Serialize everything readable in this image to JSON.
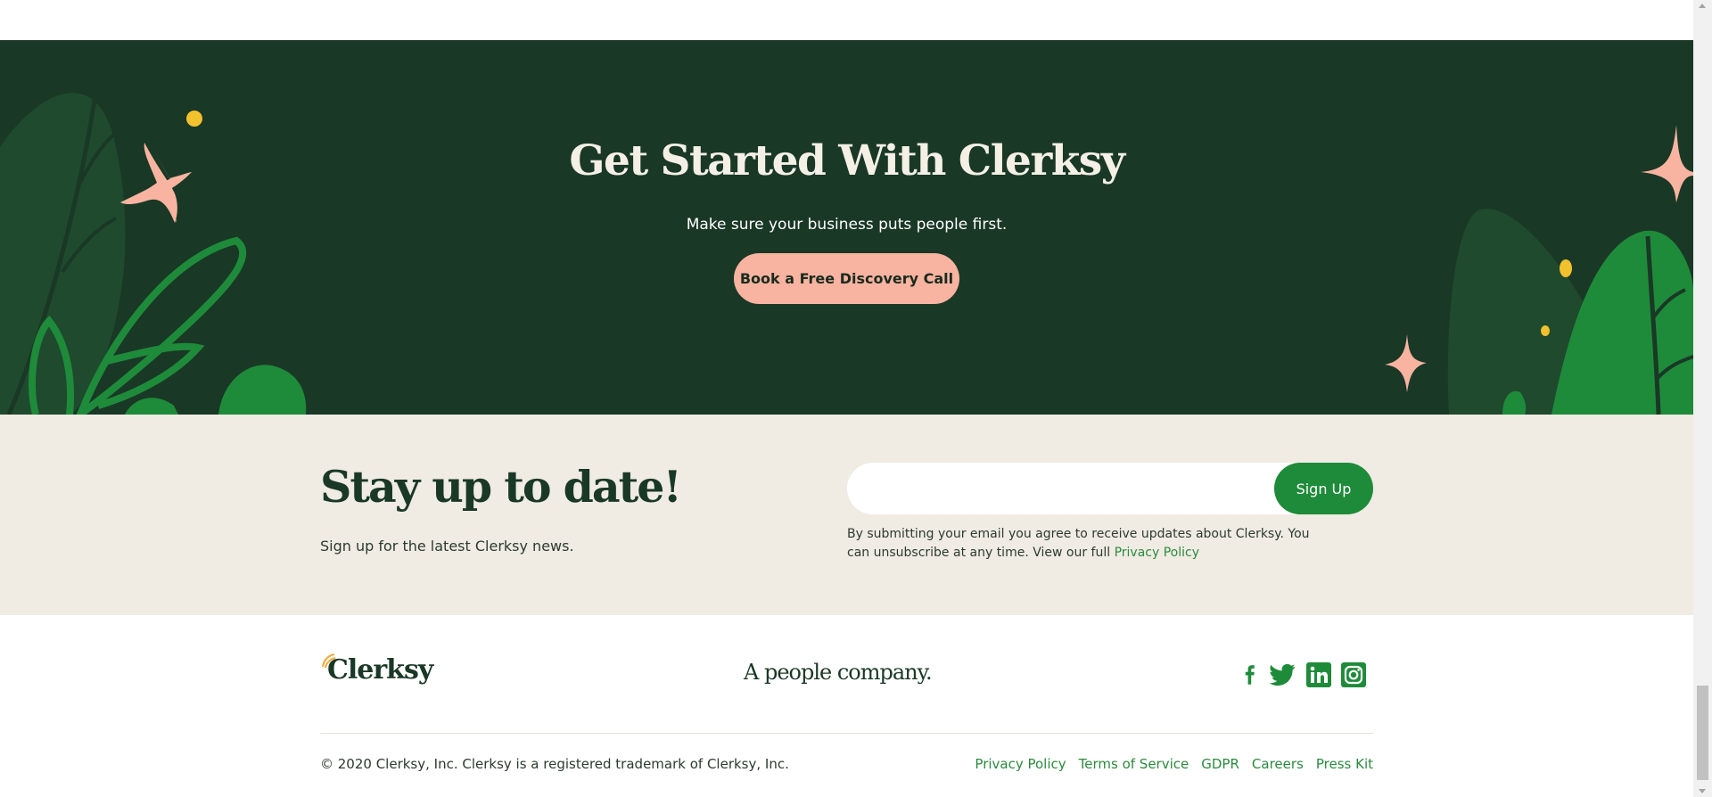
{
  "cta": {
    "title": "Get Started With Clerksy",
    "subtitle": "Make sure your business puts people first.",
    "button_label": "Book a Free Discovery Call"
  },
  "newsletter": {
    "title": "Stay up to date!",
    "subtitle": "Sign up for the latest Clerksy news.",
    "email_value": "",
    "email_placeholder": "",
    "button_label": "Sign Up",
    "legal_text": "By submitting your email you agree to receive updates about Clerksy. You can unsubscribe at any time. View our full ",
    "legal_link": "Privacy Policy"
  },
  "footer": {
    "logo_text": "Clerksy",
    "tagline": "A people company.",
    "socials": [
      {
        "name": "facebook",
        "icon": "facebook-icon"
      },
      {
        "name": "twitter",
        "icon": "twitter-icon"
      },
      {
        "name": "linkedin",
        "icon": "linkedin-icon"
      },
      {
        "name": "instagram",
        "icon": "instagram-icon"
      }
    ],
    "copyright": "© 2020 Clerksy, Inc. Clerksy is a registered trademark of Clerksy, Inc.",
    "links": [
      "Privacy Policy",
      "Terms of Service",
      "GDPR",
      "Careers",
      "Press Kit"
    ]
  },
  "colors": {
    "dark_green": "#1a3826",
    "accent_green": "#1e8b3a",
    "salmon": "#f8b4a0",
    "cream": "#f0ece3",
    "yellow": "#f2c12e"
  }
}
